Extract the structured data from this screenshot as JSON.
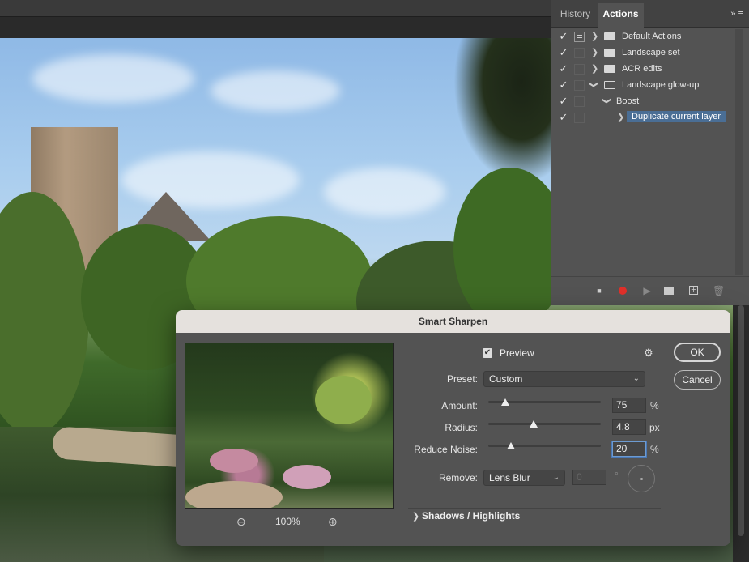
{
  "panel": {
    "tabs": [
      {
        "label": "History"
      },
      {
        "label": "Actions"
      }
    ],
    "menu_icons": "» ≡",
    "actions": [
      {
        "label": "Default Actions",
        "checked": true,
        "toggle": true,
        "expanded": false,
        "kind": "set"
      },
      {
        "label": "Landscape set",
        "checked": true,
        "toggle": false,
        "expanded": false,
        "kind": "set"
      },
      {
        "label": "ACR edits",
        "checked": true,
        "toggle": false,
        "expanded": false,
        "kind": "set"
      },
      {
        "label": "Landscape glow-up",
        "checked": true,
        "toggle": false,
        "expanded": true,
        "kind": "set"
      },
      {
        "label": "Boost",
        "checked": true,
        "toggle": false,
        "expanded": true,
        "kind": "action"
      },
      {
        "label": "Duplicate current layer",
        "checked": true,
        "toggle": false,
        "expanded": false,
        "kind": "step",
        "selected": true
      }
    ],
    "footer_icons": [
      "stop-icon",
      "record-icon",
      "play-icon",
      "new-set-icon",
      "new-action-icon",
      "trash-icon"
    ],
    "record_color": "#e0302a"
  },
  "dialog": {
    "title": "Smart Sharpen",
    "preview_label": "Preview",
    "preview_checked": true,
    "preset_label": "Preset:",
    "preset_value": "Custom",
    "amount_label": "Amount:",
    "amount_value": "75",
    "amount_unit": "%",
    "amount_fraction": 0.15,
    "radius_label": "Radius:",
    "radius_value": "4.8",
    "radius_unit": "px",
    "radius_fraction": 0.4,
    "noise_label": "Reduce Noise:",
    "noise_value": "20",
    "noise_unit": "%",
    "noise_fraction": 0.2,
    "remove_label": "Remove:",
    "remove_value": "Lens Blur",
    "angle_value": "0",
    "angle_unit": "°",
    "zoom_level": "100%",
    "shadows_label": "Shadows / Highlights",
    "ok_label": "OK",
    "cancel_label": "Cancel"
  }
}
